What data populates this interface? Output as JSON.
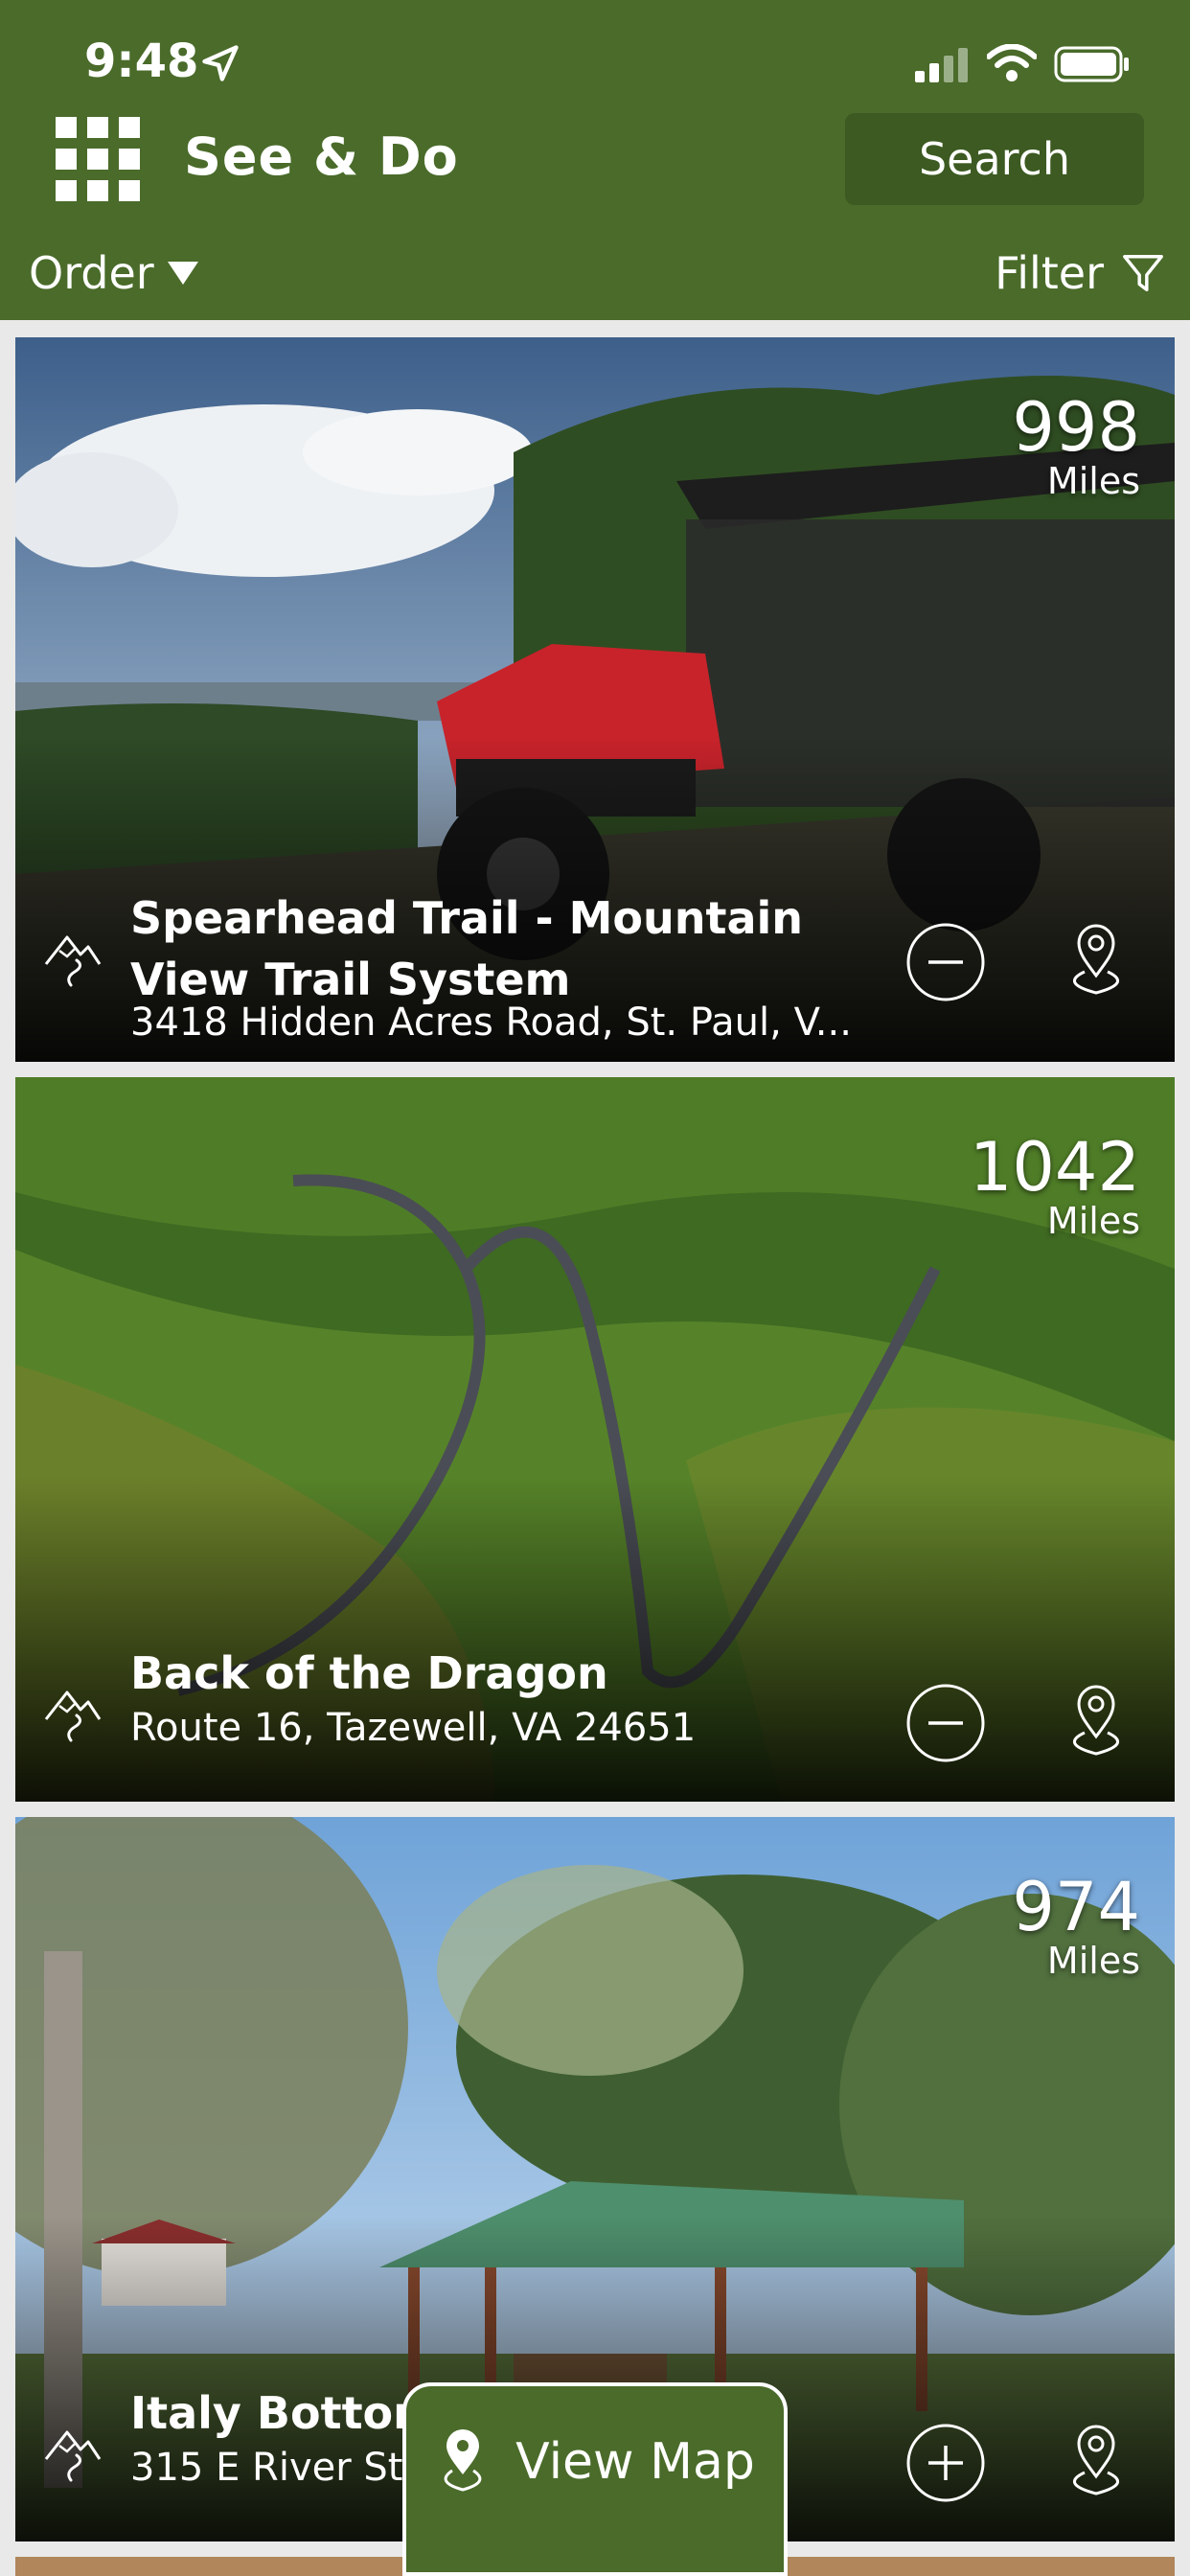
{
  "status_bar": {
    "time": "9:48"
  },
  "header": {
    "title": "See & Do",
    "search_label": "Search"
  },
  "toolbar": {
    "order_label": "Order",
    "filter_label": "Filter"
  },
  "cards": [
    {
      "title": "Spearhead Trail - Mountain View Trail System",
      "address": "3418 Hidden Acres Road, St. Paul, V...",
      "distance": "998",
      "unit": "Miles",
      "action_icon": "minus-circle-icon"
    },
    {
      "title": "Back of the Dragon",
      "address": "Route 16, Tazewell, VA 24651",
      "distance": "1042",
      "unit": "Miles",
      "action_icon": "minus-circle-icon"
    },
    {
      "title": "Italy Bottom",
      "address": "315 E River Str...",
      "distance": "974",
      "unit": "Miles",
      "action_icon": "plus-circle-icon"
    }
  ],
  "view_map_label": "View Map",
  "colors": {
    "brand_green": "#4a6b2a",
    "search_bg": "#3c5a21",
    "list_bg": "#e9e9e9"
  }
}
